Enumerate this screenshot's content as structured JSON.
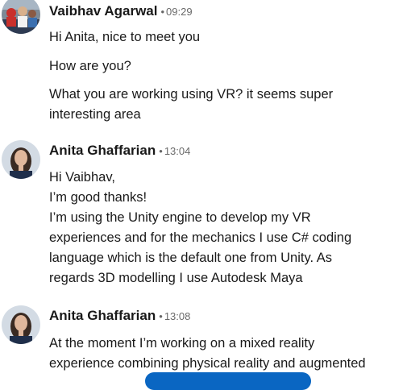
{
  "messages": [
    {
      "sender": "Vaibhav Agarwal",
      "time": "09:29",
      "avatar": "vaibhav-avatar",
      "lines": [
        "Hi Anita, nice to meet you",
        "How are you?",
        "What you are working using VR? it seems super",
        "interesting area"
      ]
    },
    {
      "sender": "Anita Ghaffarian",
      "time": "13:04",
      "avatar": "anita-avatar",
      "lines": [
        "Hi Vaibhav,",
        "I’m good thanks!",
        "I’m using the Unity engine to develop my VR",
        "experiences and for the mechanics I use C# coding",
        "language which is the default one from Unity. As",
        "regards 3D modelling I use Autodesk Maya"
      ]
    },
    {
      "sender": "Anita Ghaffarian",
      "time": "13:08",
      "avatar": "anita-avatar",
      "lines": [
        "At the moment I’m working on a mixed reality",
        "experience combining physical reality and augmented"
      ]
    }
  ],
  "separator": "•",
  "colors": {
    "accent": "#0a66c2",
    "text": "#191919",
    "muted": "#666666"
  }
}
